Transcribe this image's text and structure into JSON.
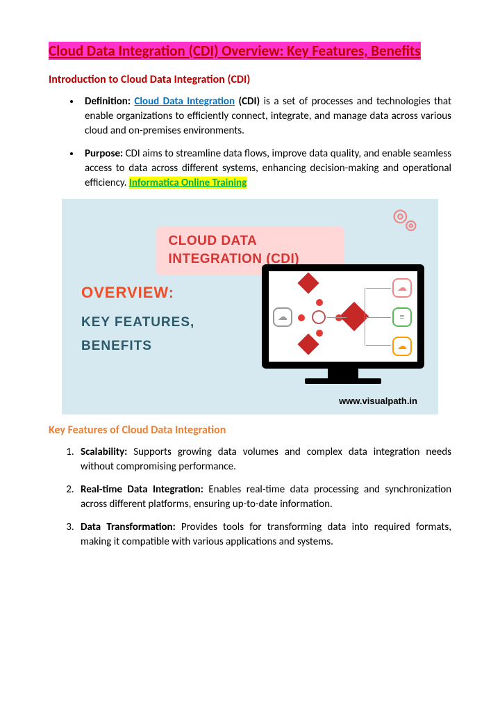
{
  "title": "Cloud Data Integration (CDI) Overview: Key Features, Benefits",
  "intro": {
    "heading": "Introduction to Cloud Data Integration (CDI)",
    "items": [
      {
        "label": "Definition:",
        "link": "Cloud Data Integration",
        "bold_post": "(CDI)",
        "text": " is a set of processes and technologies that enable organizations to efficiently connect, integrate, and manage data across various cloud and on-premises environments."
      },
      {
        "label": "Purpose:",
        "text": " CDI aims to streamline data flows, improve data quality, and enable seamless access to data across different systems, enhancing decision-making and operational efficiency. ",
        "trail_link": "Informatica Online Training"
      }
    ]
  },
  "figure": {
    "badge": "CLOUD DATA INTEGRATION (CDI)",
    "overview": "OVERVIEW:",
    "kf": "KEY FEATURES,",
    "bn": "BENEFITS",
    "url": "www.visualpath.in"
  },
  "features": {
    "heading": "Key Features of Cloud Data Integration",
    "items": [
      {
        "label": "Scalability:",
        "text": " Supports growing data volumes and complex data integration needs without compromising performance."
      },
      {
        "label": "Real-time Data Integration:",
        "text": " Enables real-time data processing and synchronization across different platforms, ensuring up-to-date information."
      },
      {
        "label": "Data Transformation:",
        "text": " Provides tools for transforming data into required formats, making it compatible with various applications and systems."
      }
    ]
  }
}
